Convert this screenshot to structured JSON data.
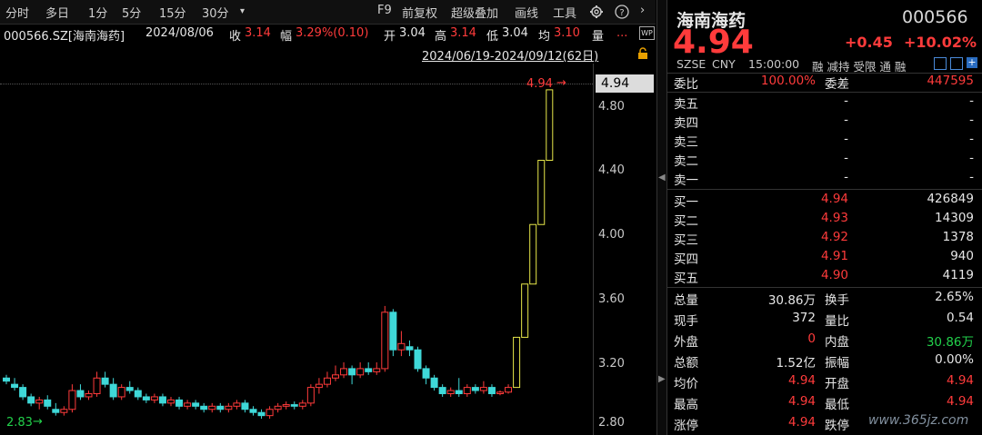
{
  "toolbar": {
    "items": [
      "分时",
      "多日",
      "1分",
      "5分",
      "15分",
      "30分",
      "F9",
      "前复权",
      "超级叠加",
      "画线",
      "工具"
    ],
    "more_icon": "dropdown-icon",
    "gear": "gear-icon",
    "help": "help-icon",
    "nav": "chevron-right-icon"
  },
  "info": {
    "code_name": "000566.SZ[海南海药]",
    "date": "2024/08/06",
    "close_label": "收",
    "close": "3.14",
    "amp_label": "幅",
    "amp": "3.29%(0.10)",
    "open_label": "开",
    "open": "3.04",
    "high_label": "高",
    "high": "3.14",
    "low_label": "低",
    "low": "3.04",
    "avg_label": "均",
    "avg": "3.10",
    "vol_label": "量",
    "more": "...",
    "range": "2024/06/19-2024/09/12(62日)",
    "wp_badge": "WP"
  },
  "chart": {
    "last_price_label": "4.94",
    "last_price_marker": "4.94",
    "min_label": "2.83",
    "yticks": [
      "4.80",
      "4.40",
      "4.00",
      "3.60",
      "3.20",
      "2.80"
    ]
  },
  "chart_data": {
    "type": "candlestick",
    "ylim": [
      2.8,
      4.98
    ],
    "candles": [
      [
        3.1,
        3.08,
        3.12,
        3.06
      ],
      [
        3.06,
        3.04,
        3.1,
        3.02
      ],
      [
        3.04,
        2.98,
        3.06,
        2.96
      ],
      [
        2.98,
        2.94,
        3.0,
        2.92
      ],
      [
        2.94,
        2.96,
        2.98,
        2.9
      ],
      [
        2.96,
        2.92,
        2.99,
        2.9
      ],
      [
        2.9,
        2.88,
        2.94,
        2.86
      ],
      [
        2.88,
        2.9,
        2.92,
        2.86
      ],
      [
        2.9,
        3.02,
        3.06,
        2.88
      ],
      [
        3.02,
        2.98,
        3.06,
        2.96
      ],
      [
        2.98,
        3.0,
        3.02,
        2.96
      ],
      [
        3.0,
        3.1,
        3.14,
        2.98
      ],
      [
        3.1,
        3.06,
        3.14,
        3.04
      ],
      [
        3.06,
        2.98,
        3.1,
        2.96
      ],
      [
        2.98,
        3.04,
        3.06,
        2.96
      ],
      [
        3.04,
        3.02,
        3.08,
        3.0
      ],
      [
        3.02,
        2.98,
        3.04,
        2.96
      ],
      [
        2.98,
        2.96,
        3.0,
        2.94
      ],
      [
        2.96,
        2.98,
        3.0,
        2.94
      ],
      [
        2.98,
        2.94,
        3.0,
        2.92
      ],
      [
        2.94,
        2.96,
        2.98,
        2.92
      ],
      [
        2.96,
        2.92,
        2.98,
        2.9
      ],
      [
        2.92,
        2.94,
        2.96,
        2.9
      ],
      [
        2.94,
        2.92,
        2.96,
        2.9
      ],
      [
        2.92,
        2.9,
        2.94,
        2.88
      ],
      [
        2.9,
        2.92,
        2.94,
        2.88
      ],
      [
        2.92,
        2.9,
        2.94,
        2.88
      ],
      [
        2.9,
        2.92,
        2.94,
        2.88
      ],
      [
        2.92,
        2.94,
        2.96,
        2.9
      ],
      [
        2.94,
        2.9,
        2.96,
        2.88
      ],
      [
        2.9,
        2.88,
        2.92,
        2.86
      ],
      [
        2.88,
        2.86,
        2.9,
        2.84
      ],
      [
        2.86,
        2.9,
        2.92,
        2.84
      ],
      [
        2.9,
        2.92,
        2.94,
        2.88
      ],
      [
        2.92,
        2.93,
        2.95,
        2.9
      ],
      [
        2.93,
        2.92,
        2.95,
        2.9
      ],
      [
        2.92,
        2.94,
        2.96,
        2.9
      ],
      [
        2.94,
        3.04,
        3.06,
        2.92
      ],
      [
        3.04,
        3.06,
        3.1,
        3.0
      ],
      [
        3.06,
        3.1,
        3.14,
        3.04
      ],
      [
        3.1,
        3.12,
        3.18,
        3.08
      ],
      [
        3.12,
        3.16,
        3.2,
        3.1
      ],
      [
        3.16,
        3.12,
        3.18,
        3.06
      ],
      [
        3.12,
        3.16,
        3.2,
        3.1
      ],
      [
        3.16,
        3.14,
        3.2,
        3.12
      ],
      [
        3.14,
        3.16,
        3.2,
        3.12
      ],
      [
        3.16,
        3.52,
        3.56,
        3.14
      ],
      [
        3.52,
        3.28,
        3.54,
        3.24
      ],
      [
        3.28,
        3.32,
        3.4,
        3.24
      ],
      [
        3.3,
        3.28,
        3.34,
        3.24
      ],
      [
        3.28,
        3.16,
        3.3,
        3.14
      ],
      [
        3.16,
        3.1,
        3.18,
        3.06
      ],
      [
        3.1,
        3.04,
        3.12,
        3.02
      ],
      [
        3.04,
        3.0,
        3.06,
        2.98
      ],
      [
        3.0,
        3.02,
        3.04,
        2.98
      ],
      [
        3.02,
        3.0,
        3.1,
        2.98
      ],
      [
        3.0,
        3.04,
        3.06,
        2.98
      ],
      [
        3.04,
        3.02,
        3.06,
        3.0
      ],
      [
        3.02,
        3.04,
        3.08,
        3.0
      ],
      [
        3.04,
        3.0,
        3.06,
        2.98
      ],
      [
        3.0,
        3.01,
        3.02,
        2.99
      ],
      [
        3.01,
        3.04,
        3.06,
        3.0
      ],
      [
        3.04,
        3.36,
        3.36,
        3.34
      ],
      [
        3.36,
        3.7,
        3.7,
        3.7
      ],
      [
        3.7,
        4.08,
        4.08,
        4.08
      ],
      [
        4.08,
        4.49,
        4.49,
        4.4
      ],
      [
        4.49,
        4.94,
        4.94,
        4.94
      ]
    ]
  },
  "quote": {
    "name": "海南海药",
    "code": "000566",
    "price": "4.94",
    "change": "+0.45",
    "change_pct": "+10.02%",
    "exchange": "SZSE",
    "currency": "CNY",
    "time": "15:00:00",
    "tags": "融 减持 受限 通 融",
    "ratio_label": "委比",
    "ratio": "100.00%",
    "diff_label": "委差",
    "diff": "447595",
    "asks": [
      {
        "label": "卖五",
        "price": "-",
        "vol": "-"
      },
      {
        "label": "卖四",
        "price": "-",
        "vol": "-"
      },
      {
        "label": "卖三",
        "price": "-",
        "vol": "-"
      },
      {
        "label": "卖二",
        "price": "-",
        "vol": "-"
      },
      {
        "label": "卖一",
        "price": "-",
        "vol": "-"
      }
    ],
    "bids": [
      {
        "label": "买一",
        "price": "4.94",
        "vol": "426849"
      },
      {
        "label": "买二",
        "price": "4.93",
        "vol": "14309"
      },
      {
        "label": "买三",
        "price": "4.92",
        "vol": "1378"
      },
      {
        "label": "买四",
        "price": "4.91",
        "vol": "940"
      },
      {
        "label": "买五",
        "price": "4.90",
        "vol": "4119"
      }
    ],
    "stats": [
      {
        "l1": "总量",
        "v1": "30.86万",
        "c1": "white",
        "l2": "换手",
        "v2": "2.65%",
        "c2": "white"
      },
      {
        "l1": "现手",
        "v1": "372",
        "c1": "white",
        "l2": "量比",
        "v2": "0.54",
        "c2": "white"
      },
      {
        "l1": "外盘",
        "v1": "0",
        "c1": "red",
        "l2": "内盘",
        "v2": "30.86万",
        "c2": "green"
      },
      {
        "l1": "总额",
        "v1": "1.52亿",
        "c1": "white",
        "l2": "振幅",
        "v2": "0.00%",
        "c2": "white"
      },
      {
        "l1": "均价",
        "v1": "4.94",
        "c1": "red",
        "l2": "开盘",
        "v2": "4.94",
        "c2": "red"
      },
      {
        "l1": "最高",
        "v1": "4.94",
        "c1": "red",
        "l2": "最低",
        "v2": "4.94",
        "c2": "red"
      },
      {
        "l1": "涨停",
        "v1": "4.94",
        "c1": "red",
        "l2": "跌停",
        "v2": "",
        "c2": "white"
      }
    ],
    "watermark": "www.365jz.com"
  }
}
